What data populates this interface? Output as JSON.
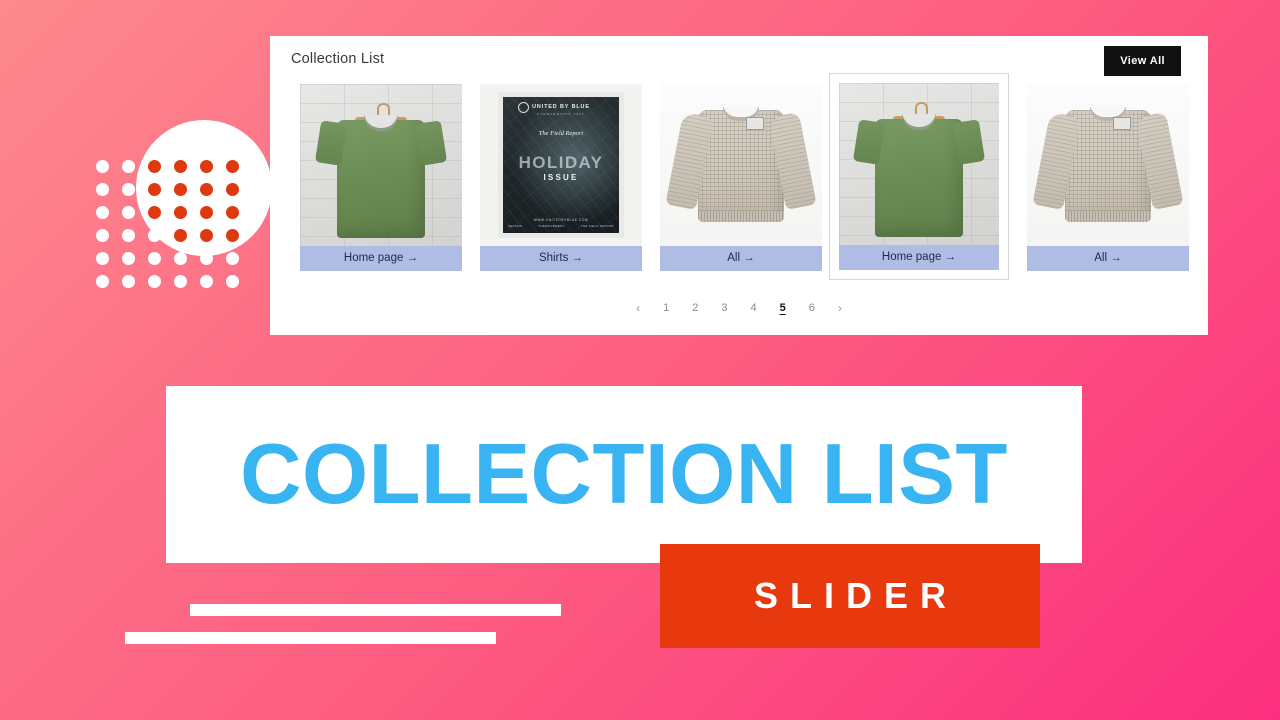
{
  "background": {
    "gradient_from": "#FD8A8E",
    "gradient_to": "#FB2F7E"
  },
  "decoration": {
    "circle_color": "#FFFFFF",
    "dot_color_default": "#FFFFFF",
    "dot_color_overlap": "#DD3A10",
    "grid_rows": 6,
    "grid_cols": 6
  },
  "panel": {
    "title": "Collection List",
    "view_all_label": "View All",
    "cards": [
      {
        "label": "Home page",
        "arrow": "→",
        "image": "green-tshirt-on-hanger",
        "selected": false
      },
      {
        "label": "Shirts",
        "arrow": "→",
        "image": "united-by-blue-holiday-issue-poster",
        "selected": false
      },
      {
        "label": "All",
        "arrow": "→",
        "image": "oatmeal-knit-sweater",
        "selected": false
      },
      {
        "label": "Home page",
        "arrow": "→",
        "image": "green-tshirt-on-hanger",
        "selected": true
      },
      {
        "label": "All",
        "arrow": "→",
        "image": "oatmeal-knit-sweater",
        "selected": false
      }
    ],
    "poster": {
      "brand": "UNITED BY BLUE",
      "brand_sub": "STEWARDSHIP 1807",
      "script": "The Field Report",
      "headline": "HOLIDAY",
      "subhead": "ISSUE",
      "foot_left": "SEASON",
      "foot_mid": "THEMOVEMENT",
      "foot_right": "THE FIELD REPORT",
      "url": "WWW.UNITEDBYBLUE.COM"
    },
    "pagination": {
      "prev": "‹",
      "next": "›",
      "pages": [
        "1",
        "2",
        "3",
        "4",
        "5",
        "6"
      ],
      "active": "5"
    }
  },
  "hero": {
    "title": "COLLECTION LIST",
    "title_color": "#39B4F2",
    "badge": "SLIDER",
    "badge_bg": "#E8380D"
  }
}
